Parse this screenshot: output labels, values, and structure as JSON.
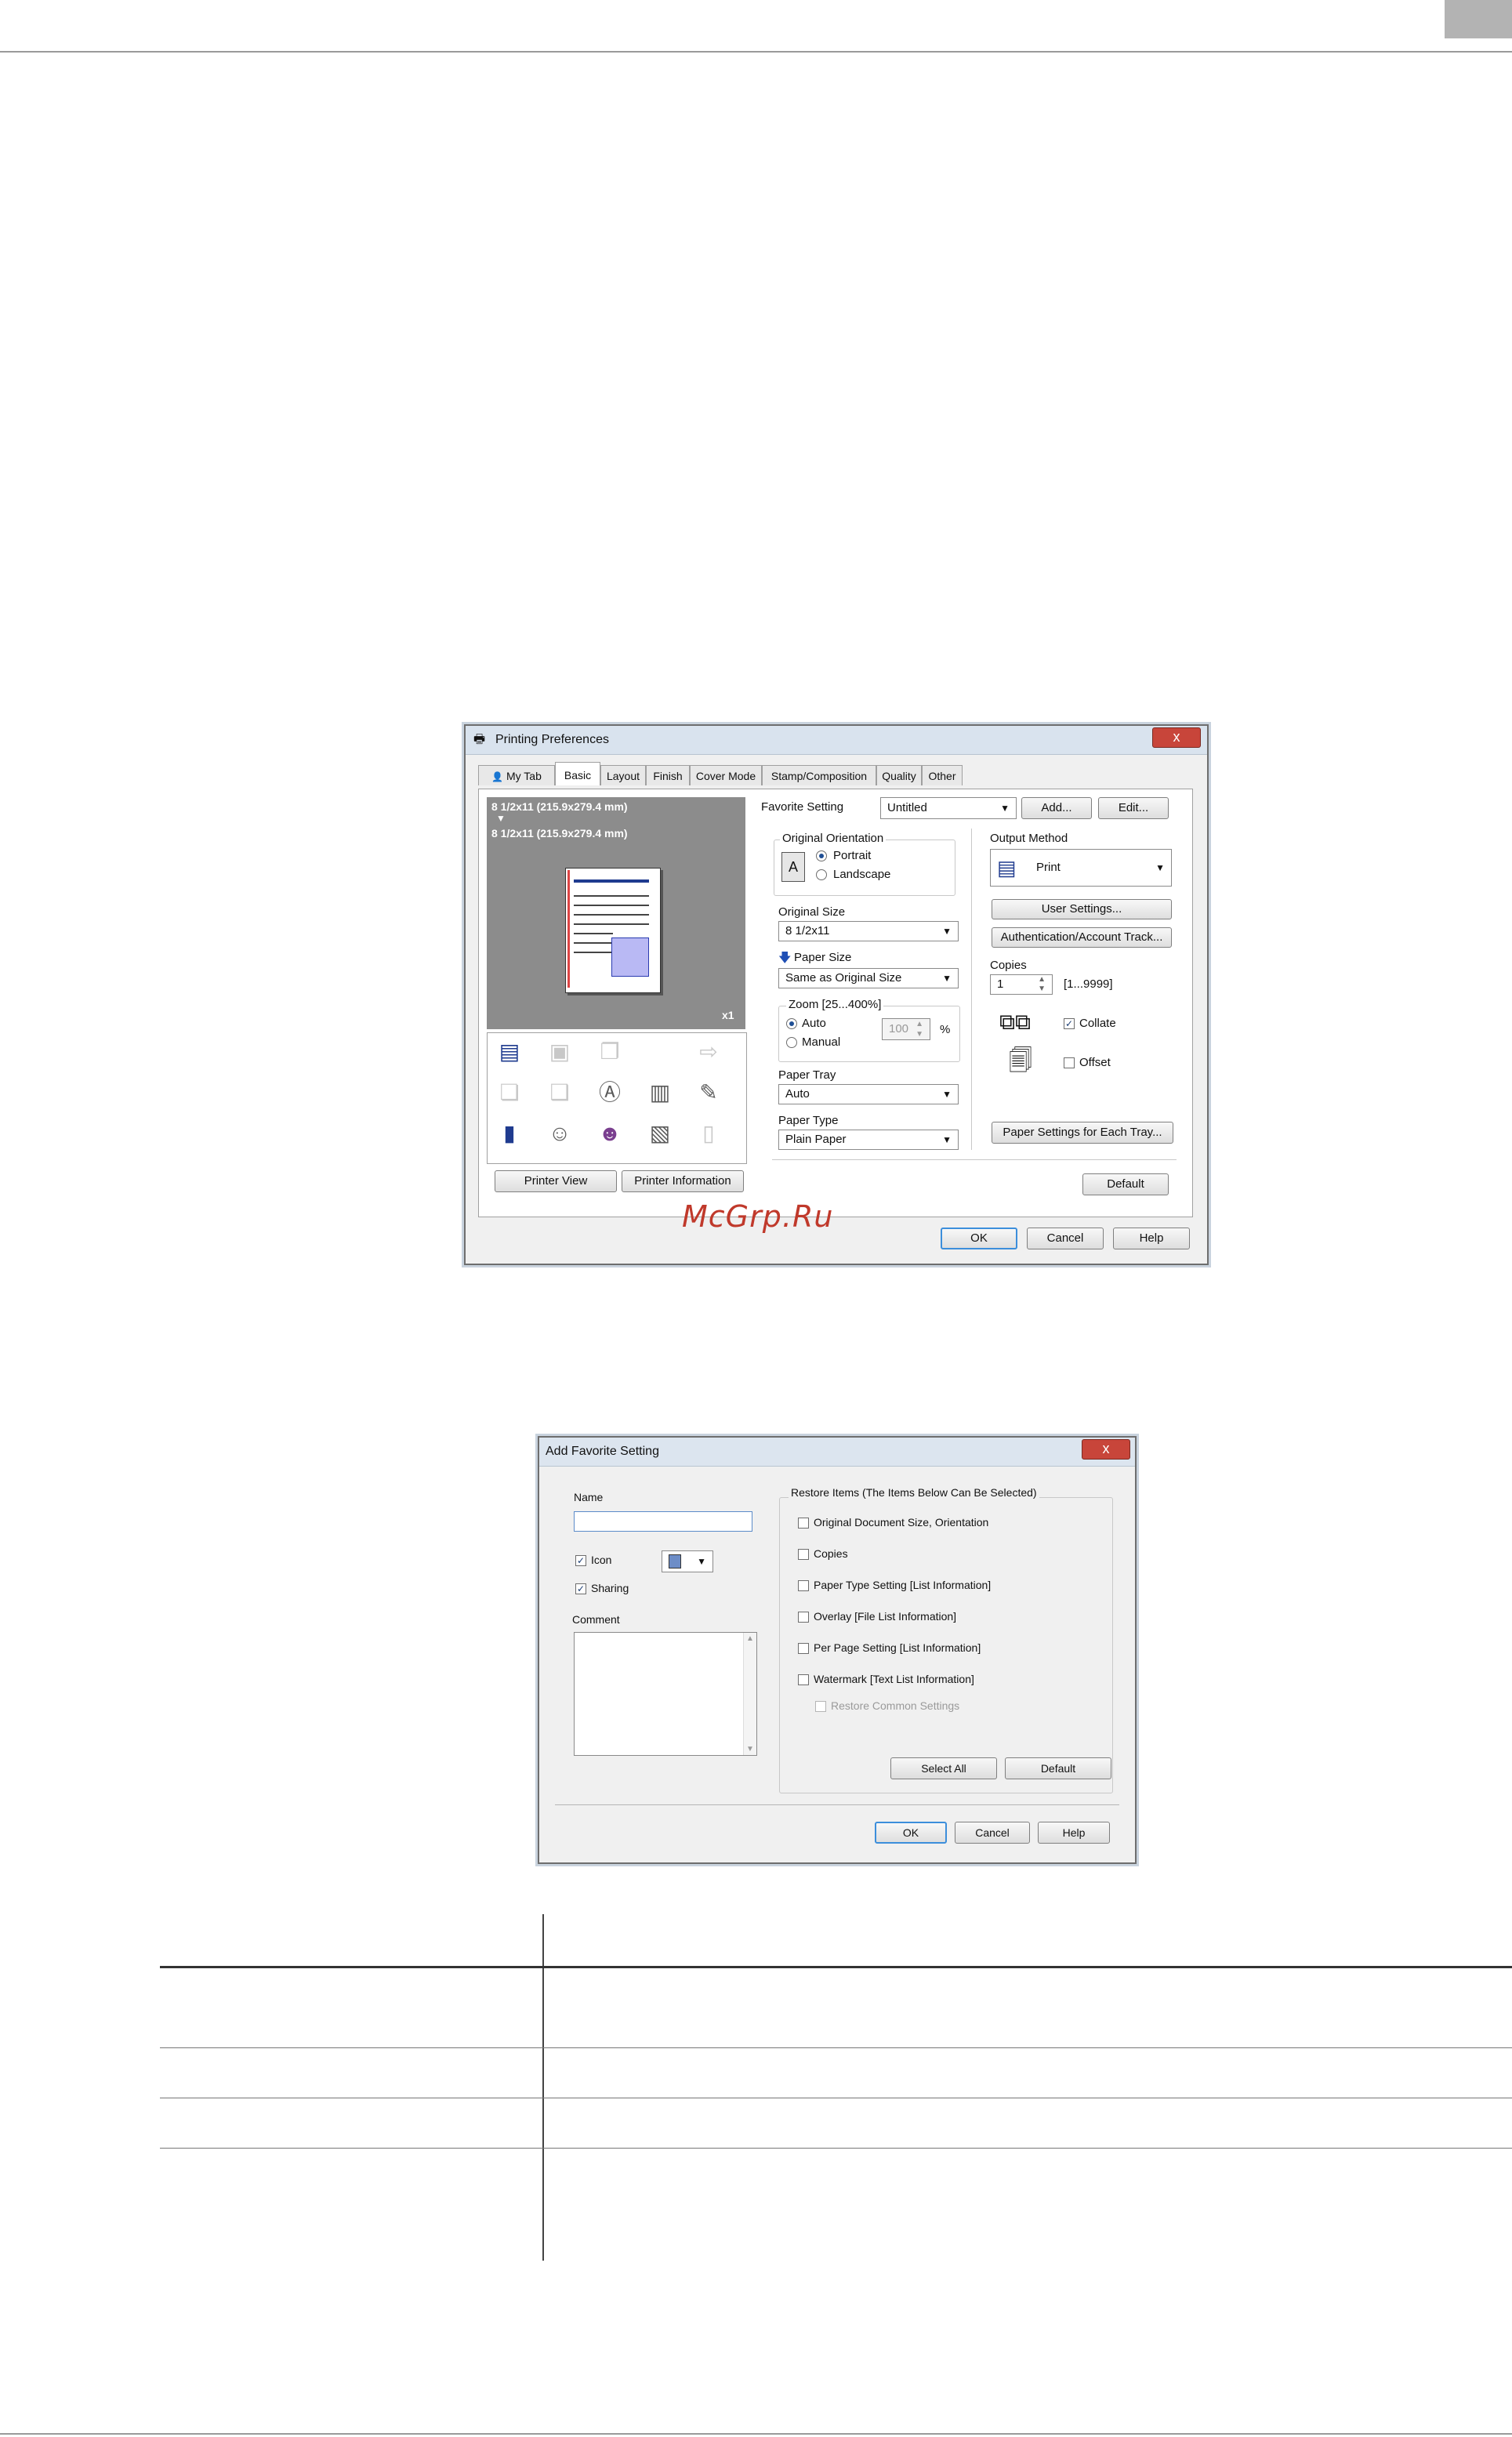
{
  "watermark": "McGrp.Ru",
  "printing_preferences": {
    "title": "Printing Preferences",
    "close": "x",
    "tabs": [
      "My Tab",
      "Basic",
      "Layout",
      "Finish",
      "Cover Mode",
      "Stamp/Composition",
      "Quality",
      "Other"
    ],
    "active_tab": "Basic",
    "preview": {
      "size_line_1": "8 1/2x11 (215.9x279.4 mm)",
      "size_line_2": "8 1/2x11 (215.9x279.4 mm)",
      "copies_badge": "x1"
    },
    "printer_view_button": "Printer View",
    "printer_information_button": "Printer Information",
    "favorite_setting": {
      "label": "Favorite Setting",
      "value": "Untitled",
      "add_button": "Add...",
      "edit_button": "Edit..."
    },
    "original_orientation": {
      "label": "Original Orientation",
      "portrait": "Portrait",
      "landscape": "Landscape",
      "selected": "Portrait"
    },
    "original_size": {
      "label": "Original Size",
      "value": "8 1/2x11"
    },
    "paper_size": {
      "label": "Paper Size",
      "value": "Same as Original Size"
    },
    "zoom": {
      "label": "Zoom [25...400%]",
      "auto": "Auto",
      "manual": "Manual",
      "value": "100",
      "unit": "%",
      "selected": "Auto"
    },
    "paper_tray": {
      "label": "Paper Tray",
      "value": "Auto"
    },
    "paper_type": {
      "label": "Paper Type",
      "value": "Plain Paper"
    },
    "output_method": {
      "label": "Output Method",
      "value": "Print"
    },
    "user_settings_button": "User Settings...",
    "authentication_button": "Authentication/Account Track...",
    "copies": {
      "label": "Copies",
      "value": "1",
      "range": "[1...9999]"
    },
    "collate": {
      "label": "Collate",
      "checked": true
    },
    "offset": {
      "label": "Offset",
      "checked": false
    },
    "paper_settings_each_tray_button": "Paper Settings for Each Tray...",
    "default_button": "Default",
    "ok_button": "OK",
    "cancel_button": "Cancel",
    "help_button": "Help"
  },
  "add_favorite": {
    "title": "Add Favorite Setting",
    "close": "x",
    "name_label": "Name",
    "name_value": "",
    "icon": {
      "label": "Icon",
      "checked": true
    },
    "sharing": {
      "label": "Sharing",
      "checked": true
    },
    "comment_label": "Comment",
    "restore_group_label": "Restore Items (The Items Below Can Be Selected)",
    "restore_items": [
      "Original Document Size, Orientation",
      "Copies",
      "Paper Type Setting [List Information]",
      "Overlay [File List Information]",
      "Per Page Setting [List Information]",
      "Watermark [Text List Information]"
    ],
    "restore_common": "Restore Common Settings",
    "select_all_button": "Select All",
    "default_button": "Default",
    "ok_button": "OK",
    "cancel_button": "Cancel",
    "help_button": "Help"
  }
}
